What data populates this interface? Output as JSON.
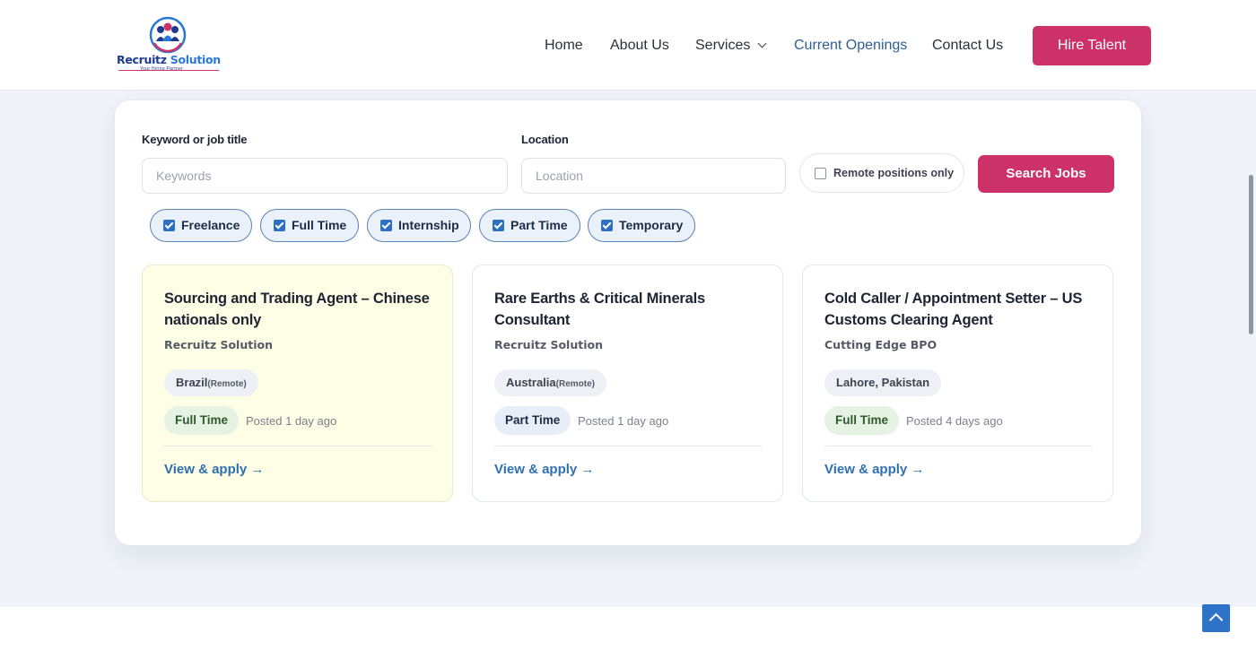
{
  "brand": {
    "name_part1": "Recruitz",
    "name_part2": " Solution",
    "tagline": "Your Hiring Partner",
    "colors": {
      "primary": "#cc3268",
      "link": "#2f6faf",
      "nav_active": "#2f5f94"
    }
  },
  "nav": {
    "items": [
      {
        "label": "Home",
        "active": false
      },
      {
        "label": "About Us",
        "active": false
      },
      {
        "label": "Services",
        "active": false,
        "has_dropdown": true
      },
      {
        "label": "Current Openings",
        "active": true
      },
      {
        "label": "Contact Us",
        "active": false
      }
    ],
    "cta_label": "Hire Talent"
  },
  "search": {
    "keyword_label": "Keyword or job title",
    "keyword_placeholder": "Keywords",
    "keyword_value": "",
    "location_label": "Location",
    "location_placeholder": "Location",
    "location_value": "",
    "remote_label": "Remote positions only",
    "remote_checked": false,
    "submit_label": "Search Jobs"
  },
  "filters": [
    {
      "label": "Freelance",
      "checked": true
    },
    {
      "label": "Full Time",
      "checked": true
    },
    {
      "label": "Internship",
      "checked": true
    },
    {
      "label": "Part Time",
      "checked": true
    },
    {
      "label": "Temporary",
      "checked": true
    }
  ],
  "jobs": [
    {
      "title": "Sourcing and Trading Agent – Chinese nationals only",
      "company": "Recruitz Solution",
      "location": "Brazil",
      "remote_tag": "(Remote)",
      "type": "Full Time",
      "posted": "Posted 1 day ago",
      "apply": "View & apply →",
      "featured": true
    },
    {
      "title": "Rare Earths & Critical Minerals Consultant",
      "company": "Recruitz Solution",
      "location": "Australia",
      "remote_tag": "(Remote)",
      "type": "Part Time",
      "posted": "Posted 1 day ago",
      "apply": "View & apply →",
      "featured": false
    },
    {
      "title": "Cold Caller / Appointment Setter – US Customs Clearing Agent",
      "company": "Cutting Edge BPO",
      "location": "Lahore, Pakistan",
      "remote_tag": "",
      "type": "Full Time",
      "posted": "Posted 4 days ago",
      "apply": "View & apply →",
      "featured": false
    }
  ],
  "icons": {
    "logo": "people-group-logo",
    "dropdown": "chevron-down-icon",
    "back_to_top": "chevron-up-icon",
    "checkbox": "check-icon"
  }
}
